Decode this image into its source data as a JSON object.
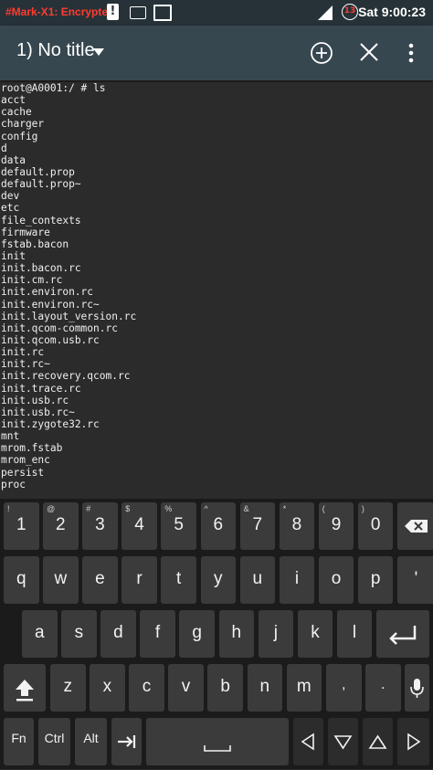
{
  "status_bar": {
    "encryption_label": "#Mark-X1: Encrypted",
    "warning_glyph": "!",
    "battery_level": "13",
    "clock": "Sat 9:00:23"
  },
  "app_bar": {
    "title": "1) No title"
  },
  "terminal": {
    "lines": [
      "root@A0001:/ # ls",
      "acct",
      "cache",
      "charger",
      "config",
      "d",
      "data",
      "default.prop",
      "default.prop~",
      "dev",
      "etc",
      "file_contexts",
      "firmware",
      "fstab.bacon",
      "init",
      "init.bacon.rc",
      "init.cm.rc",
      "init.environ.rc",
      "init.environ.rc~",
      "init.layout_version.rc",
      "init.qcom-common.rc",
      "init.qcom.usb.rc",
      "init.rc",
      "init.rc~",
      "init.recovery.qcom.rc",
      "init.trace.rc",
      "init.usb.rc",
      "init.usb.rc~",
      "init.zygote32.rc",
      "mnt",
      "mrom.fstab",
      "mrom_enc",
      "persist",
      "proc"
    ]
  },
  "keyboard": {
    "number_row": [
      {
        "label": "1",
        "hint": "!"
      },
      {
        "label": "2",
        "hint": "@"
      },
      {
        "label": "3",
        "hint": "#"
      },
      {
        "label": "4",
        "hint": "$"
      },
      {
        "label": "5",
        "hint": "%"
      },
      {
        "label": "6",
        "hint": "^"
      },
      {
        "label": "7",
        "hint": "&"
      },
      {
        "label": "8",
        "hint": "*"
      },
      {
        "label": "9",
        "hint": "("
      },
      {
        "label": "0",
        "hint": ")"
      }
    ],
    "row_q": [
      "q",
      "w",
      "e",
      "r",
      "t",
      "y",
      "u",
      "i",
      "o",
      "p"
    ],
    "quote_key": "'",
    "row_a": [
      "a",
      "s",
      "d",
      "f",
      "g",
      "h",
      "j",
      "k",
      "l"
    ],
    "row_z": [
      "z",
      "x",
      "c",
      "v",
      "b",
      "n",
      "m"
    ],
    "comma_key": ",",
    "period_key": ".",
    "fn_label": "Fn",
    "ctrl_label": "Ctrl",
    "alt_label": "Alt"
  },
  "colors": {
    "status_bar_bg": "#263238",
    "app_bar_bg": "#37474f",
    "terminal_bg": "#2b2b2b",
    "key_bg": "#3b3b3b",
    "encrypted_text": "#ff3b30"
  }
}
